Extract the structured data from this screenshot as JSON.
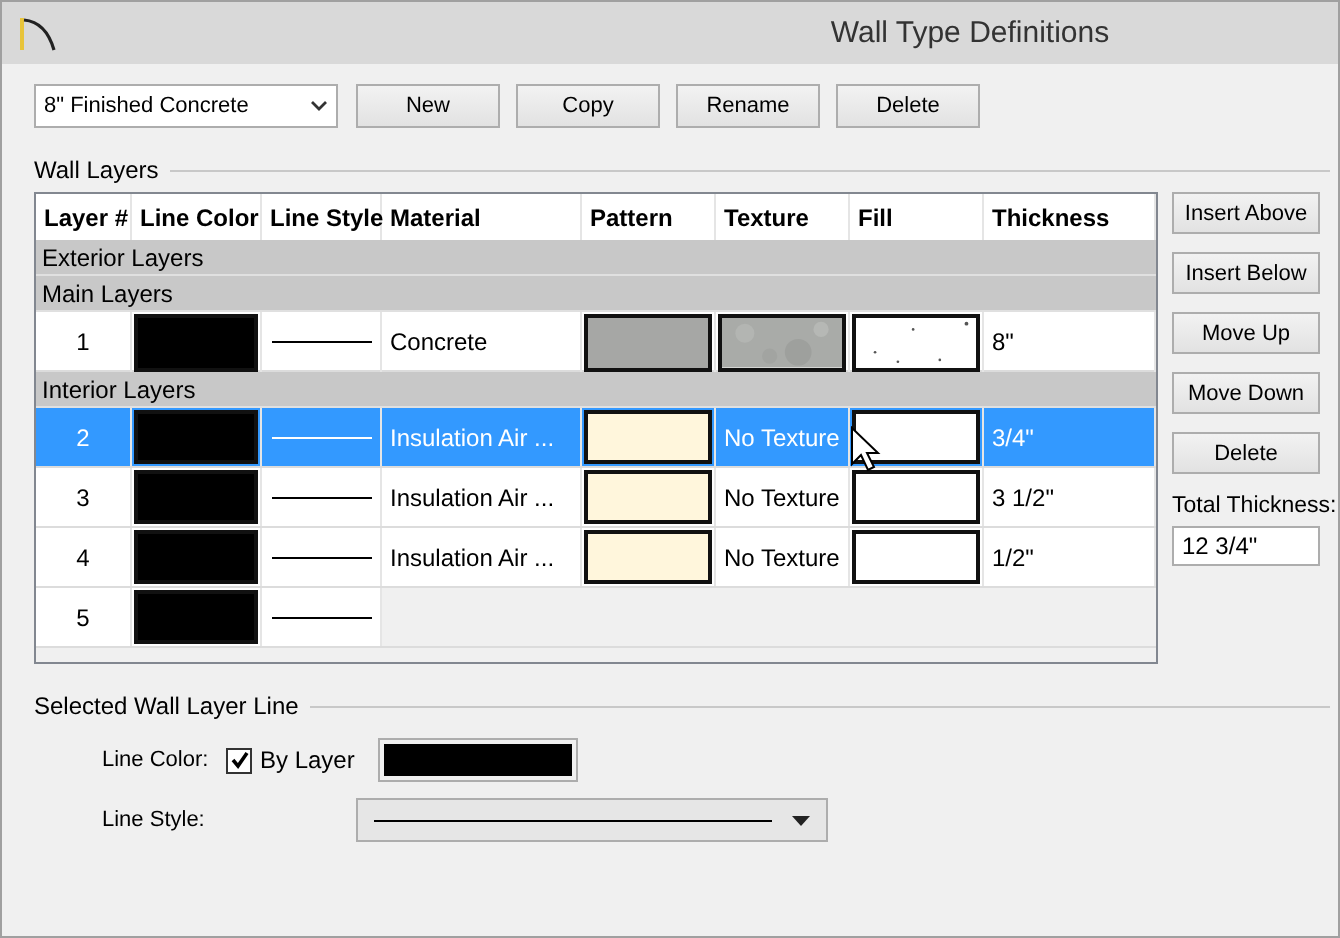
{
  "window": {
    "title": "Wall Type Definitions"
  },
  "wall_type": {
    "value": "8\" Finished Concrete"
  },
  "top_buttons": [
    "New",
    "Copy",
    "Rename",
    "Delete"
  ],
  "wall_layers": {
    "label": "Wall Layers",
    "columns": [
      "Layer #",
      "Line Color",
      "Line Style",
      "Material",
      "Pattern",
      "Texture",
      "Fill",
      "Thickness"
    ],
    "rows": [
      {
        "kind": "group",
        "label": "Exterior Layers"
      },
      {
        "kind": "group",
        "label": "Main Layers"
      },
      {
        "kind": "layer",
        "number": "1",
        "selected": false,
        "material": "Concrete",
        "pattern": {
          "color": "#a6a7a5"
        },
        "fill": {
          "kind": "dots"
        },
        "thickness": "8\""
      },
      {
        "kind": "group",
        "label": "Interior Layers"
      },
      {
        "kind": "layer",
        "number": "2",
        "selected": true,
        "material": "Insulation  Air ...",
        "pattern": {
          "color": "#fff6dc"
        },
        "texture": {
          "kind": "text",
          "label": "No Texture"
        },
        "fill": {
          "kind": "plain"
        },
        "thickness": "3/4\""
      },
      {
        "kind": "layer",
        "number": "3",
        "selected": false,
        "material": "Insulation  Air ...",
        "pattern": {
          "color": "#fff6dc"
        },
        "texture": {
          "kind": "text",
          "label": "No Texture"
        },
        "fill": {
          "kind": "plain"
        },
        "thickness": "3 1/2\""
      },
      {
        "kind": "layer",
        "number": "4",
        "selected": false,
        "material": "Insulation  Air ...",
        "pattern": {
          "color": "#fff6dc"
        },
        "texture": {
          "kind": "text",
          "label": "No Texture"
        },
        "fill": {
          "kind": "plain"
        },
        "thickness": "1/2\""
      },
      {
        "kind": "new_layer",
        "number": "5",
        "selected": false
      }
    ]
  },
  "side_buttons": [
    "Insert Above",
    "Insert Below",
    "Move Up",
    "Move Down",
    "Delete"
  ],
  "total_thickness": {
    "label": "Total Thickness:",
    "value": "12 3/4\""
  },
  "selected_line": {
    "label": "Selected Wall Layer Line",
    "line_color_label": "Line Color:",
    "by_layer": {
      "label": "By Layer",
      "checked": true
    },
    "line_style_label": "Line Style:"
  }
}
